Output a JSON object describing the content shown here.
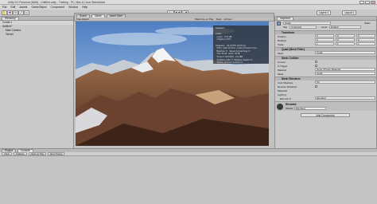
{
  "window": {
    "title": "Unity 5.0 Personal (64bit) - Untitled.unity - Training - PC, Mac & Linux Standalone"
  },
  "menu": [
    "File",
    "Edit",
    "Assets",
    "GameObject",
    "Component",
    "Window",
    "Help"
  ],
  "toolbar": {
    "layers": "Layers",
    "layout": "Layout",
    "play": "▶",
    "pause": "❚❚",
    "step": "▶❚"
  },
  "hierarchy": {
    "tab": "Hierarchy",
    "create": "Create",
    "items": [
      "Untitled*",
      "Main Camera",
      "Terrain"
    ]
  },
  "scene_tabs": {
    "scene": "Scene",
    "game": "Game",
    "asset_store": "Asset Store"
  },
  "game_view": {
    "aspect": "Free Aspect",
    "maximize": "Maximize on Play",
    "stats": "Stats",
    "gizmos": "Gizmos"
  },
  "stats_overlay": "Statistics\n\nAudio:\n  Level: -74.8 dB\n  Clipping: 0.0%\n\nGraphics:   91.8 FPS (10.9ms)\n  CPU: main 10.9ms  render thread 2.1ms\n  Batches: 6   Saved by batching: 0\n  Tris: 54.2k  Verts: 32.8k\n  Screen: 512x334 - 2.0 MB\n  SetPass calls: 5  Shadow casters: 0\n  Visible skinned meshes: 0\n  Animations: 0",
  "console": {
    "tabs": [
      "Project",
      "Console"
    ],
    "tools": [
      "Clear",
      "Collapse",
      "Clear on Play",
      "Error Pause"
    ]
  },
  "inspector": {
    "tab": "Inspector",
    "object_name": "Quad",
    "static": "Static",
    "tag_label": "Tag",
    "tag": "Untagged",
    "layer_label": "Layer",
    "layer": "Default",
    "transform": {
      "title": "Transform",
      "position": "Position",
      "rotation": "Rotation",
      "scale": "Scale",
      "pos": [
        "0",
        "0",
        "0"
      ],
      "rot": [
        "0",
        "0",
        "0"
      ],
      "scl": [
        "1",
        "1",
        "1"
      ]
    },
    "mesh_filter": {
      "title": "Quad (Mesh Filter)",
      "mesh_label": "Mesh",
      "mesh": "Quad"
    },
    "mesh_collider": {
      "title": "Mesh Collider",
      "convex": "Convex",
      "trigger": "Is Trigger",
      "material": "Material",
      "material_value": "None (Physic Material)",
      "mesh": "Mesh",
      "mesh_value": "Quad"
    },
    "mesh_renderer": {
      "title": "Mesh Renderer",
      "cast": "Cast Shadows",
      "cast_value": "On",
      "receive": "Receive Shadows",
      "materials": "Materials",
      "lighting": "Lighting",
      "element": "Element 0",
      "element_value": "Elevated"
    },
    "material": {
      "name": "Elevated",
      "shader_label": "Shader",
      "shader": "Elevated"
    },
    "add_component": "Add Component"
  },
  "colors": {
    "sky_top": "#4f7fc4",
    "sky_bottom": "#b9d3ea",
    "rock": "#8a5a3c",
    "snow": "#f2f4f6"
  }
}
